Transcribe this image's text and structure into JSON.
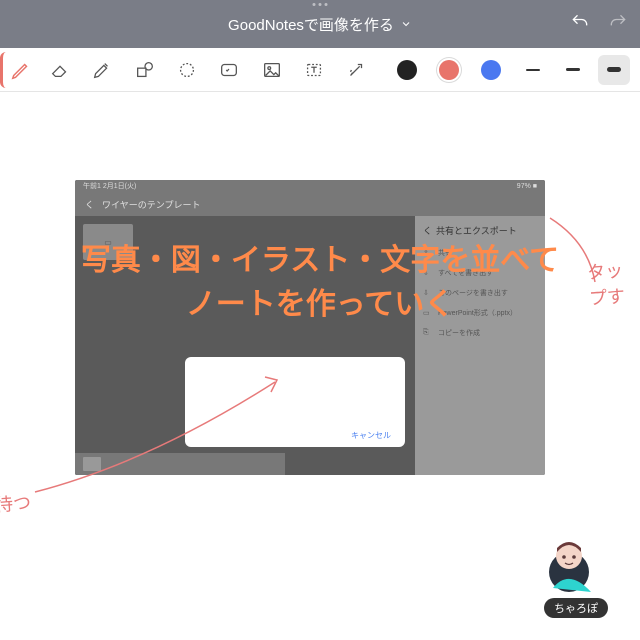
{
  "header": {
    "title": "GoodNotesで画像を作る"
  },
  "toolbar": {
    "colors": {
      "black": "#222",
      "red": "#e8746b",
      "blue": "#4a78f0"
    },
    "thickness": [
      "thin",
      "med",
      "thick"
    ]
  },
  "innerShot": {
    "status_time": "午前1 2月1日(火)",
    "status_batt": "97%",
    "back": "く",
    "title": "ワイヤーのテンプレート",
    "sidePanel": {
      "header": "共有とエクスポート",
      "items": [
        "共有",
        "すべてを書き出す",
        "このページを書き出す",
        "PowerPoint形式（.pptx）",
        "コピーを作成"
      ]
    },
    "dialog": {
      "cancel": "キャンセル"
    }
  },
  "handwriting": {
    "tap": "タップす",
    "wait": "待つ"
  },
  "overlay": {
    "line1": "写真・図・イラスト・文字を並べて",
    "line2": "ノートを作っていく"
  },
  "avatar": {
    "name": "ちゃろぽ"
  }
}
